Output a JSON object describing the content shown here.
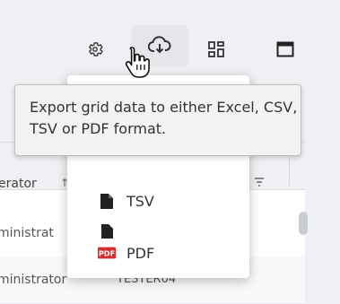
{
  "toolbar": {
    "icons": [
      "gear-icon",
      "cloud-download-icon",
      "grid-view-icon",
      "window-icon"
    ]
  },
  "tooltip": {
    "text": "Export grid data to either Excel, CSV, TSV or PDF format."
  },
  "export_menu": {
    "items": [
      {
        "label": "TSV",
        "icon": "file-icon"
      },
      {
        "label": "PDF",
        "icon": "pdf-icon"
      }
    ]
  },
  "grid": {
    "header_text": "erator",
    "rows": [
      {
        "user": "ministrat",
        "host": ""
      },
      {
        "user": "ministrator",
        "host": "TESTER04"
      }
    ]
  }
}
